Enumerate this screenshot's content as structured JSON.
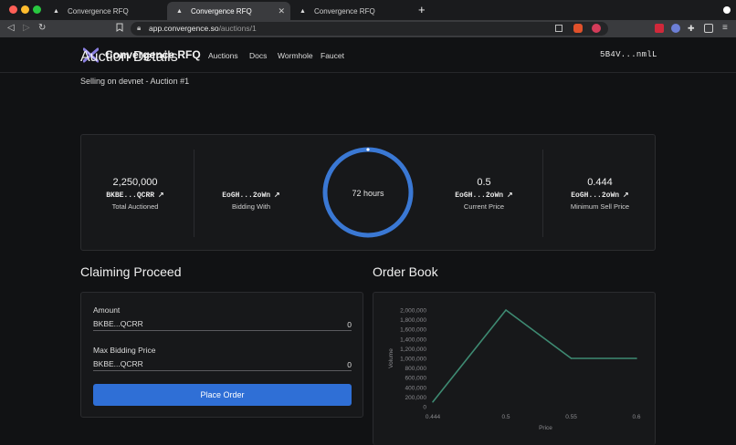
{
  "browser": {
    "tabs": [
      {
        "title": "Convergence RFQ"
      },
      {
        "title": "Convergence RFQ"
      },
      {
        "title": "Convergence RFQ"
      }
    ],
    "url_host": "app.convergence.so",
    "url_path": "/auctions/1"
  },
  "nav": {
    "brand": "Convergence RFQ",
    "links": [
      "Auctions",
      "Docs",
      "Wormhole",
      "Faucet"
    ],
    "wallet": "5B4V...nmlL"
  },
  "page": {
    "title": "Auction Details",
    "subtitle": "Selling on devnet - Auction #1"
  },
  "stats": [
    {
      "value": "2,250,000",
      "token": "BKBE...QCRR",
      "label": "Total Auctioned"
    },
    {
      "value": "",
      "token": "EoGH...2oWn",
      "label": "Bidding With"
    },
    {
      "value": "0.5",
      "token": "EoGH...2oWn",
      "label": "Current Price"
    },
    {
      "value": "0.444",
      "token": "EoGH...2oWn",
      "label": "Minimum Sell Price"
    }
  ],
  "timer": {
    "label": "72 hours",
    "progress": 1.0,
    "color": "#3a78d4"
  },
  "claiming": {
    "title": "Claiming Proceed",
    "amount_label": "Amount",
    "amount_token": "BKBE...QCRR",
    "amount_value": "0",
    "price_label": "Max Bidding Price",
    "price_token": "BKBE...QCRR",
    "price_value": "0",
    "button": "Place Order"
  },
  "orderbook": {
    "title": "Order Book"
  },
  "colors": {
    "accent": "#2f6fd6",
    "line": "#3e8a72"
  },
  "chart_data": {
    "type": "line",
    "x": [
      0.444,
      0.5,
      0.55,
      0.6
    ],
    "y": [
      100000,
      2000000,
      1000000,
      1000000
    ],
    "xlabel": "Price",
    "ylabel": "Volume",
    "xticks": [
      "0.444",
      "0.5",
      "0.55",
      "0.6"
    ],
    "yticks": [
      "0",
      "200,000",
      "400,000",
      "600,000",
      "800,000",
      "1,000,000",
      "1,200,000",
      "1,400,000",
      "1,600,000",
      "1,800,000",
      "2,000,000"
    ],
    "ylim": [
      0,
      2000000
    ],
    "xlim": [
      0.444,
      0.6
    ],
    "grid": false
  }
}
